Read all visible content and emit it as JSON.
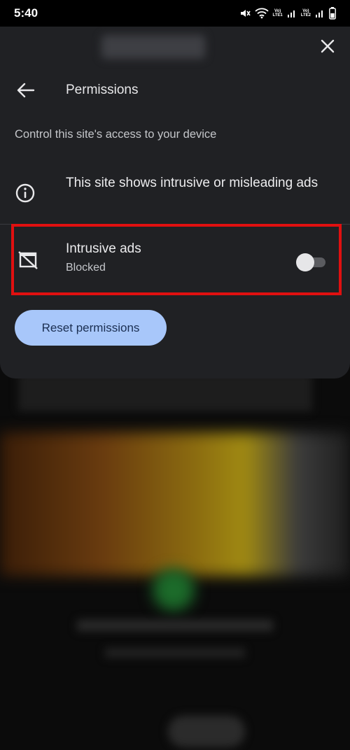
{
  "status_bar": {
    "time": "5:40",
    "lte1": "LTE1",
    "lte2": "LTE2"
  },
  "panel": {
    "close_icon": "close-icon",
    "back_icon": "arrow-left-icon",
    "title": "Permissions",
    "subtitle": "Control this site's access to your device",
    "info": {
      "icon": "info-icon",
      "text": "This site shows intrusive or misleading ads"
    },
    "intrusive_ads": {
      "icon": "blocked-ads-icon",
      "title": "Intrusive ads",
      "status": "Blocked",
      "toggle_on": false
    },
    "reset_button": "Reset permissions"
  },
  "colors": {
    "panel_bg": "#202124",
    "accent_button": "#a8c7fa",
    "highlight_border": "#e01010"
  }
}
